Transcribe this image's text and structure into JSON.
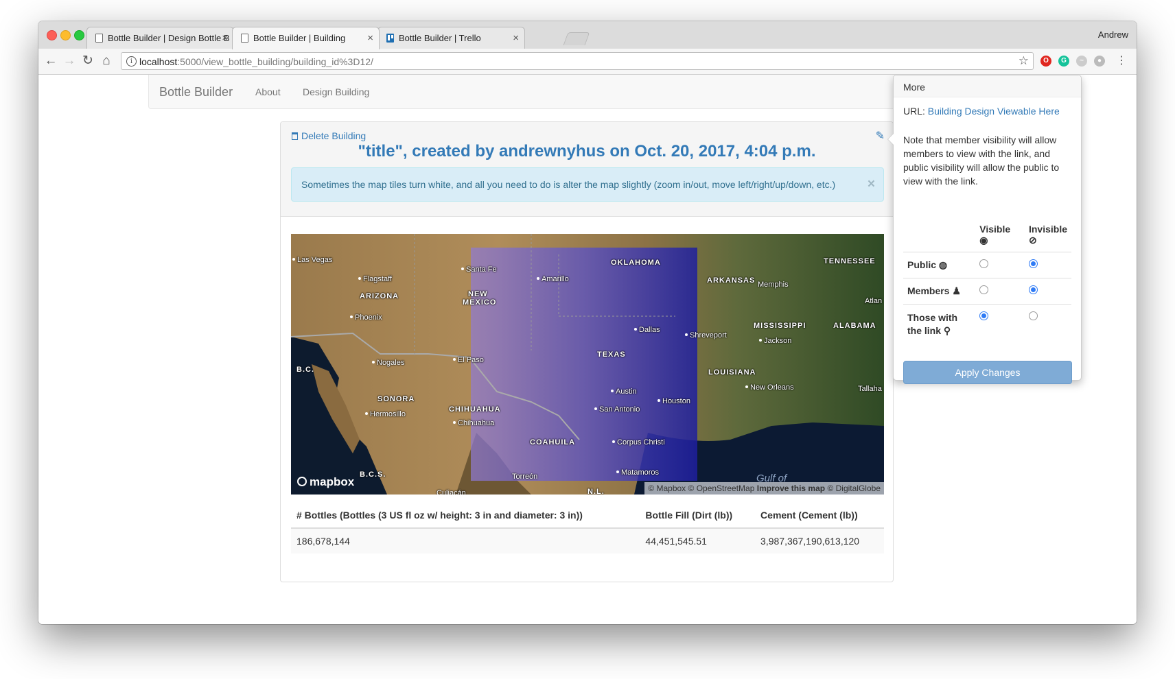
{
  "browser": {
    "tabs": [
      {
        "label": "Bottle Builder | Design Bottle B"
      },
      {
        "label": "Bottle Builder | Building"
      },
      {
        "label": "Bottle Builder | Trello"
      }
    ],
    "profile_name": "Andrew",
    "url_host": "localhost",
    "url_path": ":5000/view_bottle_building/building_id%3D12/"
  },
  "navbar": {
    "brand": "Bottle Builder",
    "links": [
      "About",
      "Design Building"
    ]
  },
  "building": {
    "delete_label": "Delete Building",
    "title": "\"title\", created by andrewnyhus on Oct. 20, 2017, 4:04 p.m.",
    "alert": "Sometimes the map tiles turn white, and all you need to do is alter the map slightly (zoom in/out, move left/right/up/down, etc.)",
    "alert_close": "×"
  },
  "map": {
    "attribution_left": "© Mapbox © OpenStreetMap",
    "attribution_improve": "Improve this map",
    "attribution_right": "© DigitalGlobe",
    "logo": "mapbox",
    "labels": {
      "las_vegas": "Las Vegas",
      "flagstaff": "Flagstaff",
      "arizona": "ARIZONA",
      "phoenix": "Phoenix",
      "nogales": "Nogales",
      "bc": "B.C.",
      "sonora": "SONORA",
      "hermosillo": "Hermosillo",
      "bcs": "B.C.S.",
      "culiacan": "Culiacán",
      "santa_fe": "Santa Fe",
      "new_mexico_1": "NEW",
      "new_mexico_2": "MEXICO",
      "amarillo": "Amarillo",
      "oklahoma": "OKLAHOMA",
      "el_paso": "El Paso",
      "chihuahua_state": "CHIHUAHUA",
      "chihuahua_city": "Chihuahua",
      "texas": "TEXAS",
      "dallas": "Dallas",
      "austin": "Austin",
      "san_antonio": "San Antonio",
      "houston": "Houston",
      "coahuila": "COAHUILA",
      "corpus_christi": "Corpus Christi",
      "torreon": "Torreón",
      "matamoros": "Matamoros",
      "nl": "N.L.",
      "gulf_of": "Gulf of",
      "arkansas": "ARKANSAS",
      "memphis": "Memphis",
      "tennessee": "TENNESSEE",
      "shreveport": "Shreveport",
      "mississippi": "MISSISSIPPI",
      "alabama": "ALABAMA",
      "jackson": "Jackson",
      "louisiana": "LOUISIANA",
      "new_orleans": "New Orleans",
      "atlanta": "Atlan",
      "tallahassee": "Tallaha"
    }
  },
  "results": {
    "headers": [
      "# Bottles (Bottles (3 US fl oz w/ height: 3 in and diameter: 3 in))",
      "Bottle Fill (Dirt (lb))",
      "Cement (Cement (lb))"
    ],
    "row": [
      "186,678,144",
      "44,451,545.51",
      "3,987,367,190,613,120"
    ]
  },
  "popover": {
    "title": "More",
    "url_label": "URL: ",
    "url_link": "Building Design Viewable Here",
    "note": "Note that member visibility will allow members to view with the link, and public visibility will allow the public to view with the link.",
    "col_visible": "Visible",
    "col_invisible": "Invisible",
    "rows": [
      {
        "label": "Public",
        "visible": false,
        "invisible": true
      },
      {
        "label": "Members",
        "visible": false,
        "invisible": true
      },
      {
        "label": "Those with the link",
        "visible": true,
        "invisible": false
      }
    ],
    "apply_label": "Apply Changes"
  }
}
